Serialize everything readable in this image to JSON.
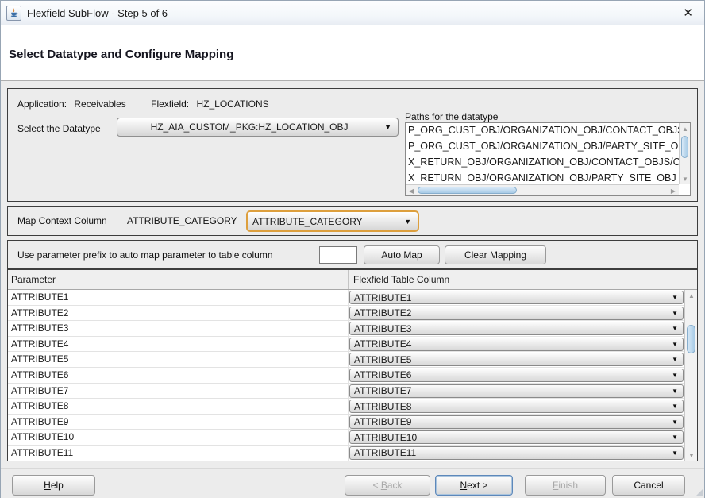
{
  "window": {
    "title": "Flexfield SubFlow - Step 5 of 6",
    "close_glyph": "✕"
  },
  "header": {
    "title": "Select Datatype and Configure Mapping"
  },
  "info": {
    "application_label": "Application:",
    "application_value": "Receivables",
    "flexfield_label": "Flexfield:",
    "flexfield_value": "HZ_LOCATIONS"
  },
  "datatype": {
    "label": "Select the Datatype",
    "selected": "HZ_AIA_CUSTOM_PKG:HZ_LOCATION_OBJ"
  },
  "paths": {
    "label": "Paths for the datatype",
    "items": [
      "P_ORG_CUST_OBJ/ORGANIZATION_OBJ/CONTACT_OBJS",
      "P_ORG_CUST_OBJ/ORGANIZATION_OBJ/PARTY_SITE_OBJS",
      "X_RETURN_OBJ/ORGANIZATION_OBJ/CONTACT_OBJS/C",
      "X_RETURN_OBJ/ORGANIZATION_OBJ/PARTY_SITE_OBJ"
    ]
  },
  "context": {
    "label": "Map Context Column",
    "column_name": "ATTRIBUTE_CATEGORY",
    "selected": "ATTRIBUTE_CATEGORY"
  },
  "prefix": {
    "label": "Use parameter prefix to auto map parameter to table column",
    "input_value": "",
    "auto_map_label": "Auto Map",
    "clear_mapping_label": "Clear Mapping"
  },
  "table": {
    "headers": {
      "parameter": "Parameter",
      "column": "Flexfield Table Column"
    },
    "rows": [
      {
        "parameter": "ATTRIBUTE1",
        "column": "ATTRIBUTE1"
      },
      {
        "parameter": "ATTRIBUTE2",
        "column": "ATTRIBUTE2"
      },
      {
        "parameter": "ATTRIBUTE3",
        "column": "ATTRIBUTE3"
      },
      {
        "parameter": "ATTRIBUTE4",
        "column": "ATTRIBUTE4"
      },
      {
        "parameter": "ATTRIBUTE5",
        "column": "ATTRIBUTE5"
      },
      {
        "parameter": "ATTRIBUTE6",
        "column": "ATTRIBUTE6"
      },
      {
        "parameter": "ATTRIBUTE7",
        "column": "ATTRIBUTE7"
      },
      {
        "parameter": "ATTRIBUTE8",
        "column": "ATTRIBUTE8"
      },
      {
        "parameter": "ATTRIBUTE9",
        "column": "ATTRIBUTE9"
      },
      {
        "parameter": "ATTRIBUTE10",
        "column": "ATTRIBUTE10"
      },
      {
        "parameter": "ATTRIBUTE11",
        "column": "ATTRIBUTE11"
      }
    ]
  },
  "footer": {
    "help": "Help",
    "back": "< Back",
    "next": "Next >",
    "finish": "Finish",
    "cancel": "Cancel"
  },
  "icons": {
    "dropdown": "▼",
    "scroll_up": "▲",
    "scroll_down": "▼",
    "scroll_left": "◀",
    "scroll_right": "▶"
  },
  "colors": {
    "focus_orange": "#dd9f3d",
    "focus_blue": "#5d88ba",
    "scroll_thumb": "#a8cbe6",
    "titlebar": "#f2f6fa",
    "dialog_bg": "#ececec"
  }
}
